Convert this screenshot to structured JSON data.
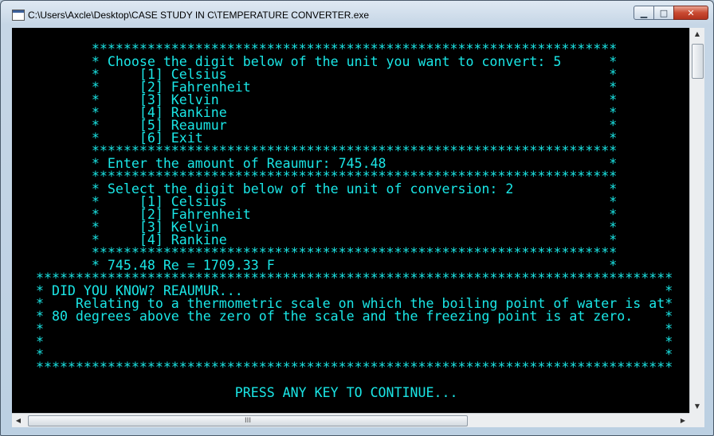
{
  "window": {
    "title": "C:\\Users\\Axcle\\Desktop\\CASE STUDY IN C\\TEMPERATURE CONVERTER.exe",
    "minimize_glyph": "▁",
    "maximize_glyph": "□",
    "close_glyph": "✕"
  },
  "console": {
    "lines": [
      "          ******************************************************************",
      "          * Choose the digit below of the unit you want to convert: 5      *",
      "          *     [1] Celsius                                                *",
      "          *     [2] Fahrenheit                                             *",
      "          *     [3] Kelvin                                                 *",
      "          *     [4] Rankine                                                *",
      "          *     [5] Reaumur                                                *",
      "          *     [6] Exit                                                   *",
      "          ******************************************************************",
      "          * Enter the amount of Reaumur: 745.48                            *",
      "          ******************************************************************",
      "          * Select the digit below of the unit of conversion: 2            *",
      "          *     [1] Celsius                                                *",
      "          *     [2] Fahrenheit                                             *",
      "          *     [3] Kelvin                                                 *",
      "          *     [4] Rankine                                                *",
      "          ******************************************************************",
      "          * 745.48 Re = 1709.33 F                                          *",
      "   ********************************************************************************",
      "   * DID YOU KNOW? REAUMUR...                                                     *",
      "   *    Relating to a thermometric scale on which the boiling point of water is at*",
      "   * 80 degrees above the zero of the scale and the freezing point is at zero.    *",
      "   *                                                                              *",
      "   *                                                                              *",
      "   *                                                                              *",
      "   ********************************************************************************",
      "",
      "                            PRESS ANY KEY TO CONTINUE..."
    ]
  },
  "scrollbars": {
    "up_glyph": "▲",
    "down_glyph": "▼",
    "left_glyph": "◀",
    "right_glyph": "▶",
    "grip_glyph": "III"
  }
}
